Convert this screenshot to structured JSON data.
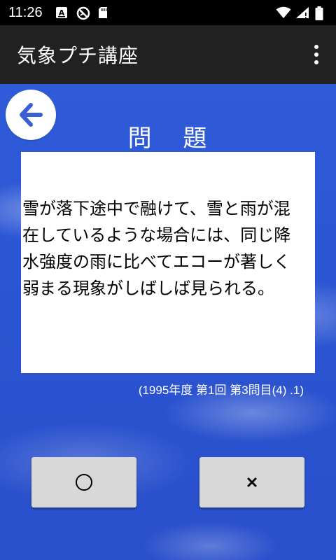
{
  "status_bar": {
    "time": "11:26",
    "icons_left": [
      "font-a-icon",
      "no-sync-icon",
      "sd-card-icon"
    ],
    "icons_right": [
      "wifi-icon",
      "signal-icon",
      "battery-icon"
    ]
  },
  "app_bar": {
    "title": "気象プチ講座",
    "overflow_icon": "more-vert-icon"
  },
  "colors": {
    "status_bar_bg": "#000000",
    "app_bar_bg": "#212121",
    "content_bg": "#2a4fd0",
    "back_arrow": "#3a5fd4",
    "button_bg": "#d8d8d8"
  },
  "main": {
    "heading": "問 題",
    "question": "雪が落下途中で融けて、雪と雨が混在しているような場合には、同じ降水強度の雨に比べてエコーが著しく弱まる現象がしばしば見られる。",
    "source": "(1995年度 第1回 第3問目(4) .1)",
    "answer_true_symbol": "○",
    "answer_false_symbol": "×"
  }
}
